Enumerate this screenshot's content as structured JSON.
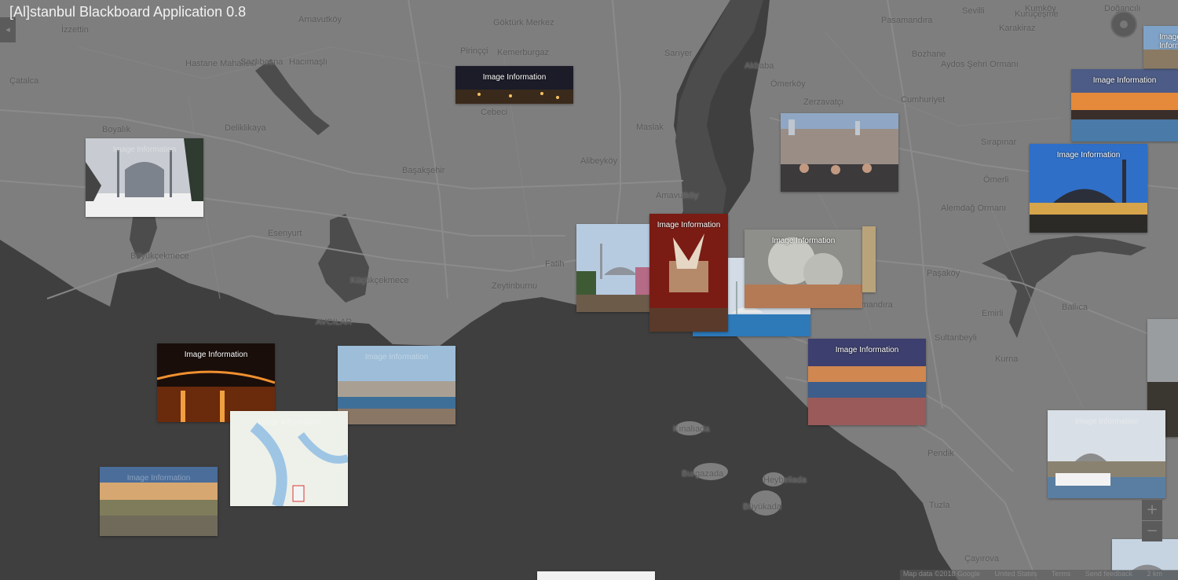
{
  "app": {
    "title": "[Al]stanbul Blackboard Application 0.8"
  },
  "colors": {
    "sea": "#3f3f3f",
    "land": "#7e7e7e",
    "water_inland": "#4c4c4c",
    "roads": "#8d8d8d",
    "caption": "#ffffff"
  },
  "map": {
    "places": [
      {
        "name": "İzzettin"
      },
      {
        "name": "Arnavutköy"
      },
      {
        "name": "Göktürk Merkez"
      },
      {
        "name": "Pirinççi"
      },
      {
        "name": "Kemerburgaz"
      },
      {
        "name": "Cebeci"
      },
      {
        "name": "Hastane Mahallesi"
      },
      {
        "name": "Sazlıbosna"
      },
      {
        "name": "Hacımaşlı"
      },
      {
        "name": "Çatalca"
      },
      {
        "name": "Deliklikaya"
      },
      {
        "name": "Boyalık"
      },
      {
        "name": "Başakşehir"
      },
      {
        "name": "Esenyurt"
      },
      {
        "name": "Büyükçekmece"
      },
      {
        "name": "Küçükçekmece"
      },
      {
        "name": "AVCILAR"
      },
      {
        "name": "Zeytinburnu"
      },
      {
        "name": "Fatih"
      },
      {
        "name": "Maslak"
      },
      {
        "name": "Alibeyköy"
      },
      {
        "name": "Sarıyer"
      },
      {
        "name": "Pasamandıra"
      },
      {
        "name": "Akbaba"
      },
      {
        "name": "Ömerköy"
      },
      {
        "name": "Zerzavatçı"
      },
      {
        "name": "Cumhuriyet"
      },
      {
        "name": "Bozhane"
      },
      {
        "name": "Alemdağ Ormanı"
      },
      {
        "name": "Samandıra"
      },
      {
        "name": "Paşaköy"
      },
      {
        "name": "Sultanbeyli"
      },
      {
        "name": "Kurna"
      },
      {
        "name": "Emirli"
      },
      {
        "name": "Ballıca"
      },
      {
        "name": "Doğancılı"
      },
      {
        "name": "Pendik"
      },
      {
        "name": "Tuzla"
      },
      {
        "name": "Çayırova"
      },
      {
        "name": "Kınalıada"
      },
      {
        "name": "Burgazada"
      },
      {
        "name": "Heybeliada"
      },
      {
        "name": "Büyükada"
      },
      {
        "name": "Karakiraz"
      },
      {
        "name": "Sırapınar"
      },
      {
        "name": "Ömerli"
      },
      {
        "name": "Kuruçeşme"
      },
      {
        "name": "Aydos Şehri Ormanı"
      },
      {
        "name": "Sevilli"
      },
      {
        "name": "Amavutköy"
      },
      {
        "name": "Kumköy"
      }
    ],
    "controls": {
      "zoom_in": "+",
      "zoom_out": "−"
    },
    "attribution": [
      "Map data ©2018 Google",
      "United States",
      "Terms",
      "Send feedback",
      "2 km"
    ]
  },
  "image_cards": {
    "caption": "Image Information",
    "items": [
      {
        "id": "snowy-mosque",
        "subject": "snowy mosque"
      },
      {
        "id": "night-city",
        "subject": "night city"
      },
      {
        "id": "crowd-hill",
        "subject": "crowd on hill"
      },
      {
        "id": "blue-mosque",
        "subject": "mosque blue sky"
      },
      {
        "id": "sunset-harbor",
        "subject": "sunset harbor"
      },
      {
        "id": "corner-card",
        "subject": "waterfront"
      },
      {
        "id": "tree-mosque",
        "subject": "mosque with trees"
      },
      {
        "id": "red-art",
        "subject": "red artwork"
      },
      {
        "id": "waterfront-mosque",
        "subject": "waterfront mosque"
      },
      {
        "id": "protest-square",
        "subject": "square with smoke"
      },
      {
        "id": "bridge-night",
        "subject": "bridge at night"
      },
      {
        "id": "city-panorama",
        "subject": "city panorama"
      },
      {
        "id": "golden-horn-dusk",
        "subject": "golden horn at dusk"
      },
      {
        "id": "street-right",
        "subject": "street"
      },
      {
        "id": "mosque-ferry",
        "subject": "mosque and ferry"
      },
      {
        "id": "city-map",
        "subject": "city map"
      },
      {
        "id": "skyline-hills",
        "subject": "skyline"
      },
      {
        "id": "bottom-right",
        "subject": "mosque skyline"
      },
      {
        "id": "bottom-white",
        "subject": "white photo"
      }
    ]
  }
}
